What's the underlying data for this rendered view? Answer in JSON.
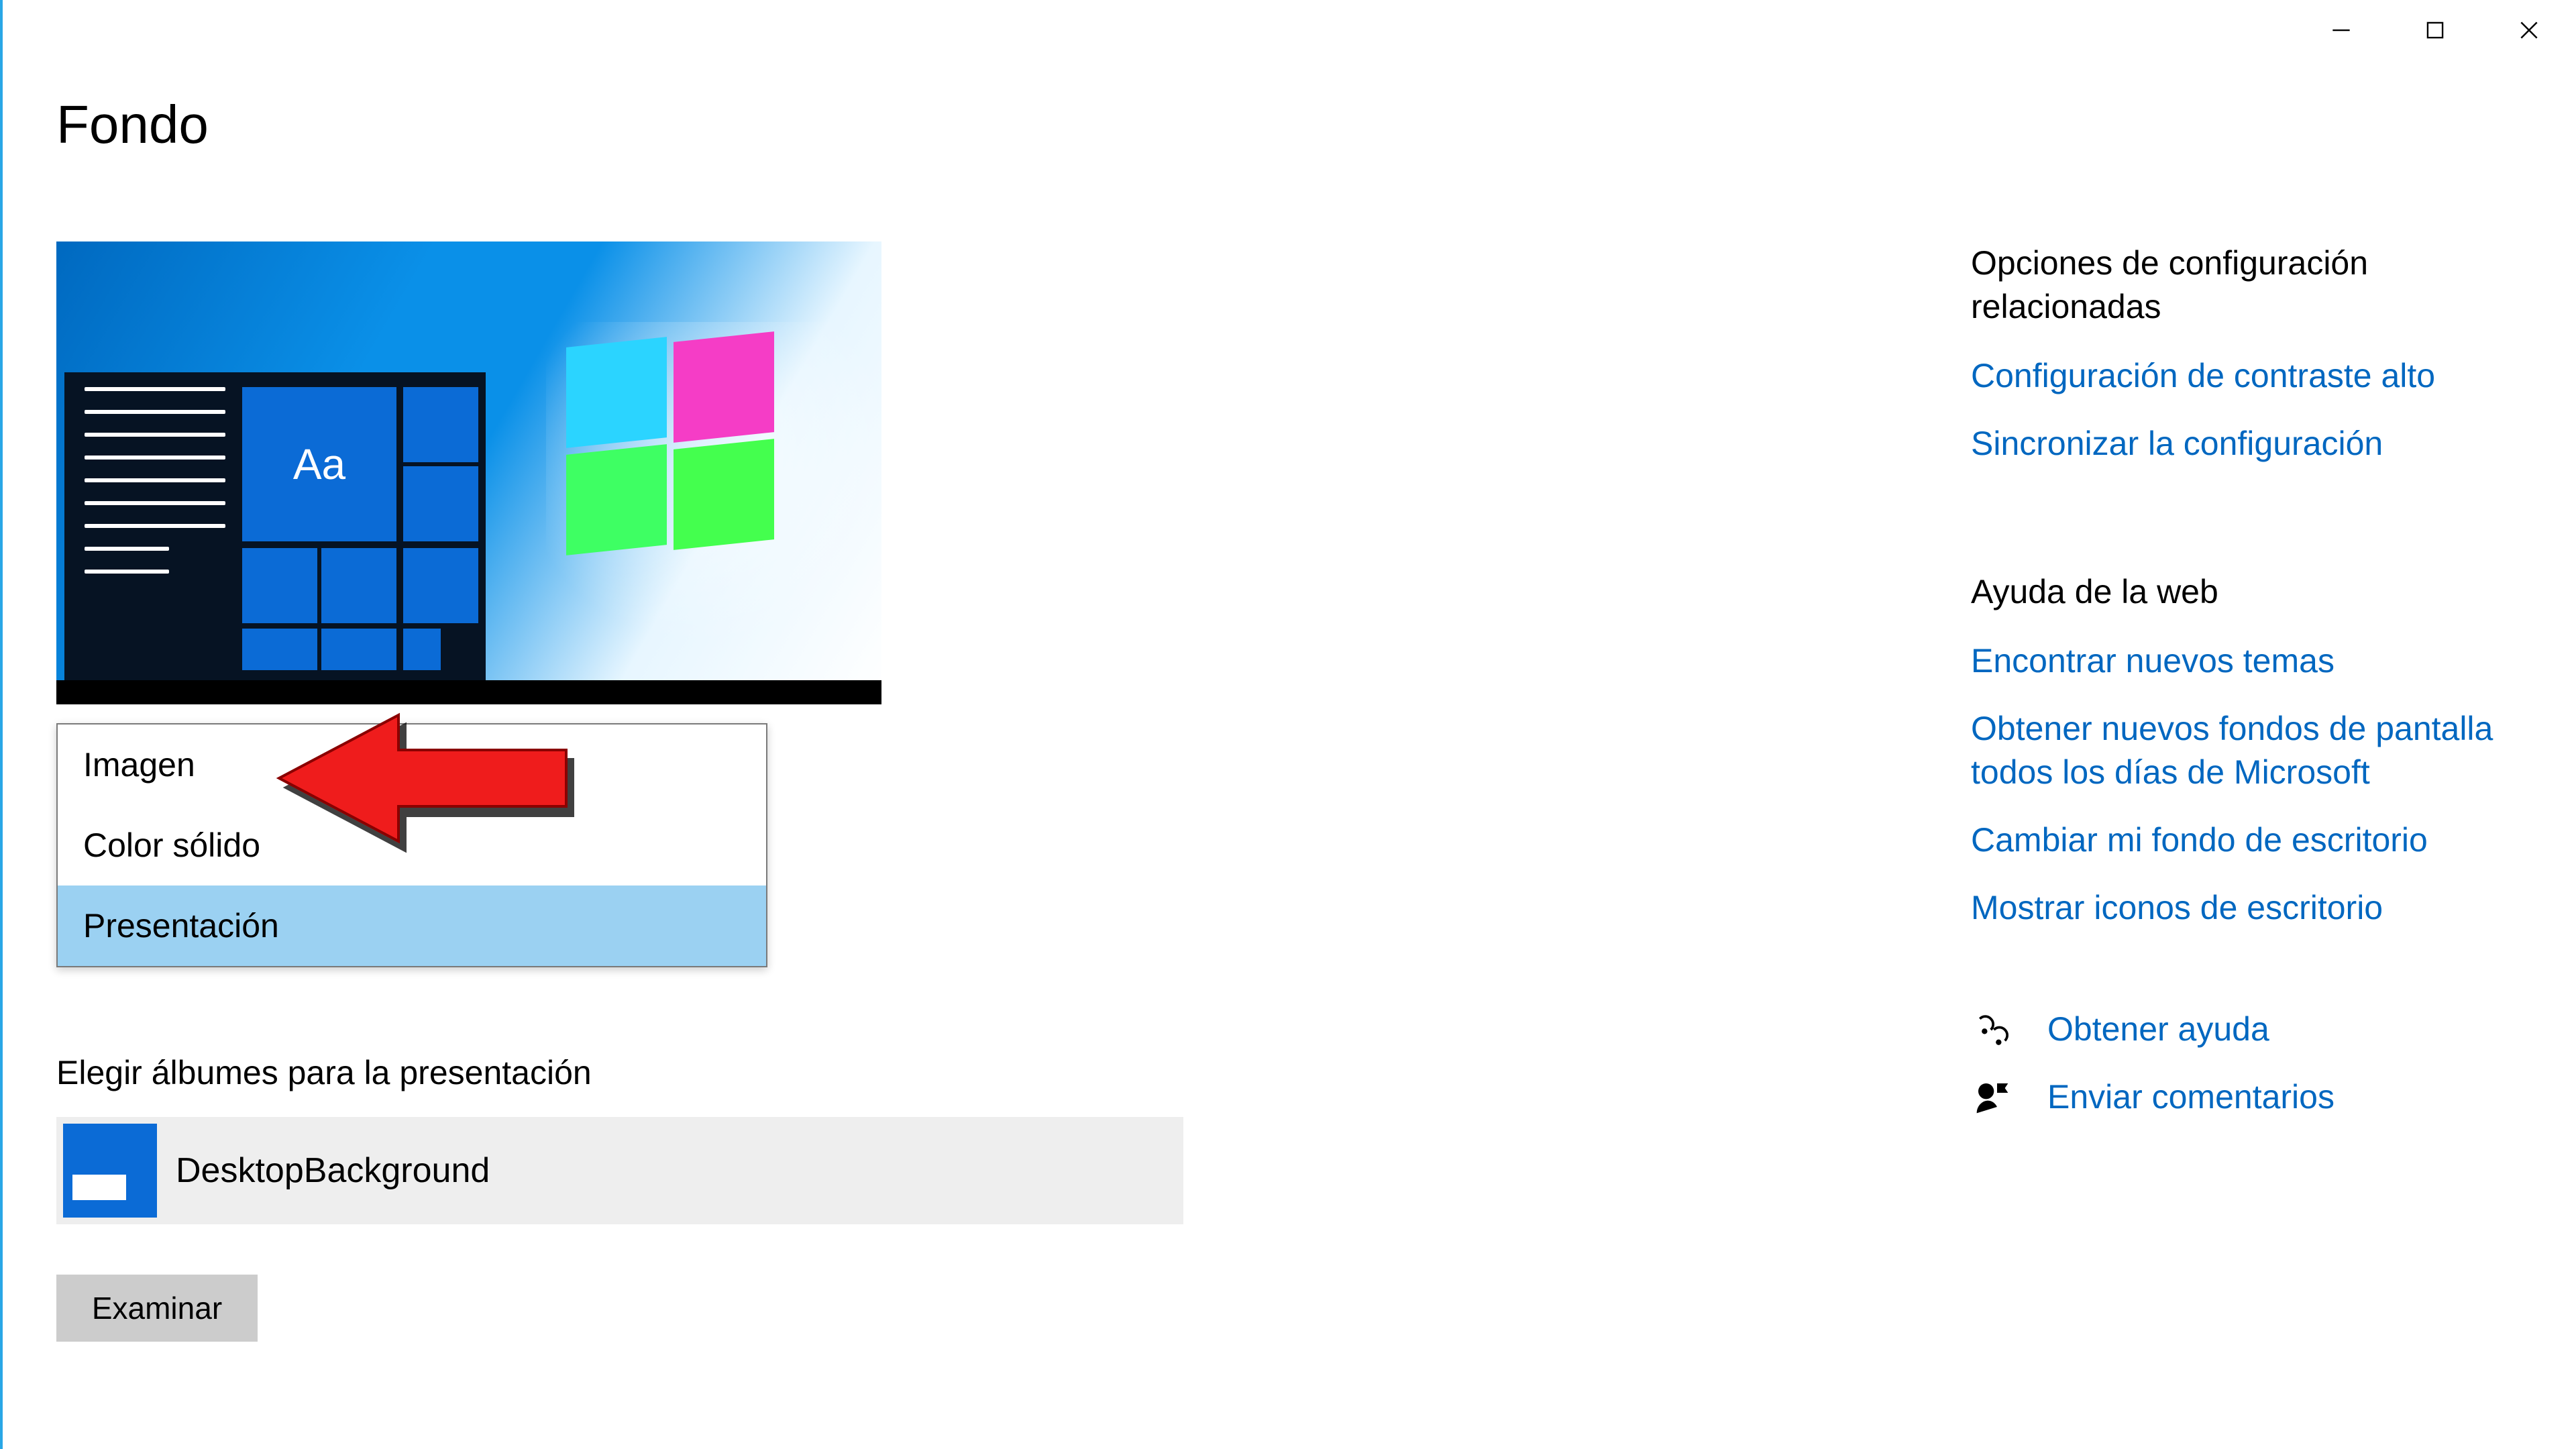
{
  "window": {
    "page_title": "Fondo"
  },
  "dropdown": {
    "options": [
      "Imagen",
      "Color sólido",
      "Presentación"
    ],
    "selected_index": 2
  },
  "preview": {
    "sample_text": "Aa"
  },
  "section": {
    "choose_label": "Elegir álbumes para la presentación",
    "album_name": "DesktopBackground",
    "browse": "Examinar"
  },
  "related": {
    "heading": "Opciones de configuración relacionadas",
    "links": [
      "Configuración de contraste alto",
      "Sincronizar la configuración"
    ]
  },
  "help": {
    "heading": "Ayuda de la web",
    "links": [
      "Encontrar nuevos temas",
      "Obtener nuevos fondos de pantalla todos los días de Microsoft",
      "Cambiar mi fondo de escritorio",
      "Mostrar iconos de escritorio"
    ]
  },
  "footer_links": {
    "get_help": "Obtener ayuda",
    "feedback": "Enviar comentarios"
  },
  "colors": {
    "accent": "#0067c0",
    "select": "#9bd1f2",
    "tile": "#0b6bd6",
    "bg_button": "#cccccc"
  }
}
